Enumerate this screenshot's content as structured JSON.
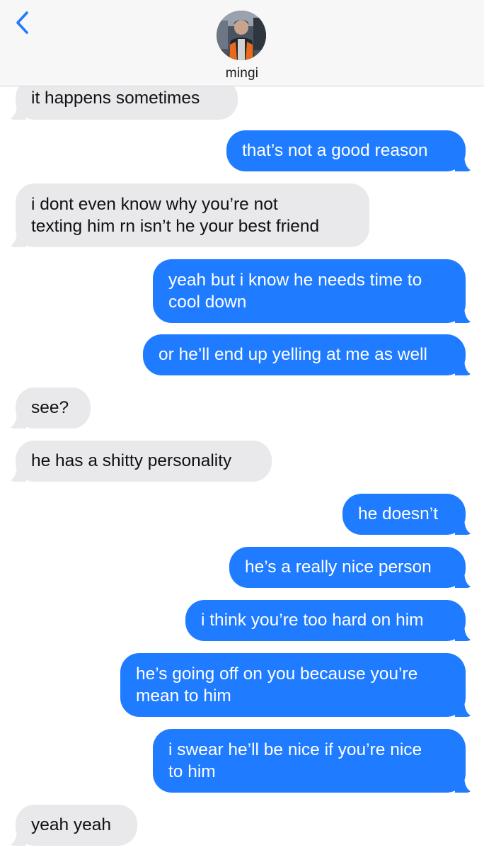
{
  "contact": {
    "name": "mingi"
  },
  "colors": {
    "outgoing": "#1f7bff",
    "incoming": "#e9e9eb",
    "accent": "#1f7bff"
  },
  "icons": {
    "back": "chevron-left-icon"
  },
  "messages": [
    {
      "direction": "in",
      "lines": [
        "it happens sometimes"
      ]
    },
    {
      "direction": "out",
      "lines": [
        "that’s not a good reason"
      ]
    },
    {
      "direction": "in",
      "lines": [
        "i dont even know why you’re not",
        "texting him rn isn’t he your best friend"
      ]
    },
    {
      "direction": "out",
      "lines": [
        "yeah but i know he needs time to",
        "cool down"
      ]
    },
    {
      "direction": "out",
      "lines": [
        "or he’ll end up yelling at me as well"
      ]
    },
    {
      "direction": "in",
      "lines": [
        "see?"
      ]
    },
    {
      "direction": "in",
      "lines": [
        "he has a shitty personality"
      ]
    },
    {
      "direction": "out",
      "lines": [
        "he doesn’t"
      ]
    },
    {
      "direction": "out",
      "lines": [
        "he’s a really nice person"
      ]
    },
    {
      "direction": "out",
      "lines": [
        "i think you’re too hard on him"
      ]
    },
    {
      "direction": "out",
      "lines": [
        "he’s going off on you because you’re",
        "mean to him"
      ]
    },
    {
      "direction": "out",
      "lines": [
        "i swear he’ll be nice if you’re nice",
        "to him"
      ]
    },
    {
      "direction": "in",
      "lines": [
        "yeah yeah"
      ]
    }
  ]
}
